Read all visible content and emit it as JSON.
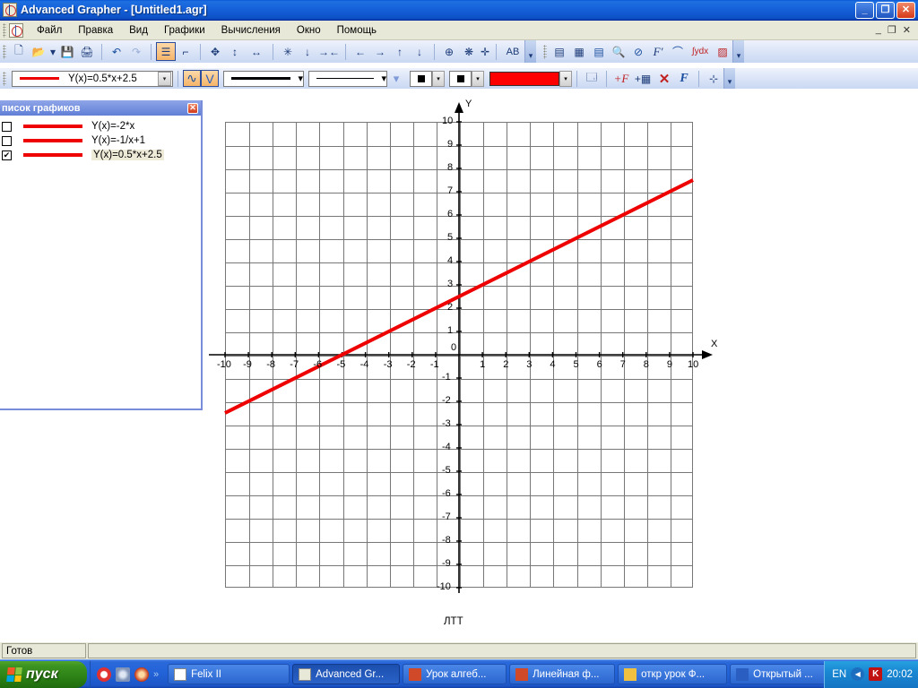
{
  "window": {
    "title": "Advanced Grapher - [Untitled1.agr]",
    "app_icon": "grapher-icon",
    "minimize": "_",
    "maximize": "❐",
    "close": "✕",
    "mdi_minimize": "_",
    "mdi_restore": "❐",
    "mdi_close": "✕"
  },
  "menu": {
    "items": [
      {
        "label": "Файл"
      },
      {
        "label": "Правка"
      },
      {
        "label": "Вид"
      },
      {
        "label": "Графики"
      },
      {
        "label": "Вычисления"
      },
      {
        "label": "Окно"
      },
      {
        "label": "Помощь"
      }
    ]
  },
  "toolbar_main": {
    "buttons": [
      {
        "name": "new-file-button",
        "glyph": "🗋"
      },
      {
        "name": "open-file-button",
        "glyph": "📂"
      },
      {
        "name": "open-dropdown-button",
        "glyph": "▾"
      },
      {
        "name": "save-button",
        "glyph": "💾"
      },
      {
        "name": "print-button",
        "glyph": "🖨"
      },
      {
        "name": "undo-button",
        "glyph": "↶"
      },
      {
        "name": "redo-button",
        "glyph": "↷"
      },
      {
        "name": "graph-list-button",
        "glyph": "☰"
      },
      {
        "name": "axes-settings-button",
        "glyph": "⌐"
      },
      {
        "name": "pan-button",
        "glyph": "✥"
      },
      {
        "name": "stretch-vertical-button",
        "glyph": "↕"
      },
      {
        "name": "stretch-horizontal-button",
        "glyph": "↔"
      },
      {
        "name": "zoom-in-button",
        "glyph": "✳"
      },
      {
        "name": "zoom-vertical-in-button",
        "glyph": "↓"
      },
      {
        "name": "zoom-horizontal-in-button",
        "glyph": "→←"
      },
      {
        "name": "scroll-left-button",
        "glyph": "←"
      },
      {
        "name": "scroll-right-button",
        "glyph": "→"
      },
      {
        "name": "scroll-up-button",
        "glyph": "↑"
      },
      {
        "name": "scroll-down-button",
        "glyph": "↓"
      },
      {
        "name": "center-origin-button",
        "glyph": "⊕"
      },
      {
        "name": "fit-all-button",
        "glyph": "❋"
      },
      {
        "name": "text-label-button",
        "glyph": "AB"
      }
    ],
    "overflow": "▾"
  },
  "toolbar_calc": {
    "buttons": [
      {
        "name": "table-button",
        "glyph": "▤"
      },
      {
        "name": "grid-table-button",
        "glyph": "▦"
      },
      {
        "name": "data-sheet-button",
        "glyph": "▤"
      },
      {
        "name": "trace-zoom-button",
        "glyph": "🔍"
      },
      {
        "name": "intersection-button",
        "glyph": "⊘"
      },
      {
        "name": "derivative-button",
        "glyph": "F'"
      },
      {
        "name": "tangent-button",
        "glyph": "⌒"
      },
      {
        "name": "integral-button",
        "glyph": "∫ydx"
      },
      {
        "name": "area-button",
        "glyph": "▨"
      }
    ],
    "overflow": "▾"
  },
  "toolbar_graph": {
    "formula_combo": {
      "name": "formula-combo",
      "value": "Y(x)=0.5*x+2.5",
      "line_color": "#ee0000",
      "arrow": "▾"
    },
    "style_buttons": [
      {
        "name": "function-style-button",
        "glyph": "∿",
        "active": true
      },
      {
        "name": "parabola-style-button",
        "glyph": "V",
        "active": true
      },
      {
        "name": "tabular-style-button",
        "glyph": "V",
        "active": false
      }
    ],
    "line_width_combo": {
      "name": "line-width-combo",
      "arrow": "▾"
    },
    "line_style_combo": {
      "name": "line-style-combo",
      "arrow": "▾"
    },
    "marker_combo": {
      "name": "marker-style-combo",
      "arrow": "▾"
    },
    "point_combo": {
      "name": "point-style-combo",
      "arrow": "▾"
    },
    "color_combo": {
      "name": "graph-color-combo",
      "color": "#ff0000",
      "arrow": "▾"
    },
    "buttons": [
      {
        "name": "graph-properties-button",
        "glyph": "🗔"
      },
      {
        "name": "add-function-button",
        "glyph": "+F"
      },
      {
        "name": "add-table-button",
        "glyph": "+▦"
      },
      {
        "name": "delete-graph-button",
        "glyph": "✕"
      },
      {
        "name": "edit-function-button",
        "glyph": "F"
      },
      {
        "name": "graph-properties2-button",
        "glyph": "⊹"
      }
    ],
    "overflow": "▾"
  },
  "graph_list": {
    "title": "писок графиков",
    "close": "✕",
    "rows": [
      {
        "checked": false,
        "label": "Y(x)=-2*x",
        "color": "#ee0000",
        "selected": false
      },
      {
        "checked": false,
        "label": "Y(x)=-1/x+1",
        "color": "#ee0000",
        "selected": false
      },
      {
        "checked": true,
        "label": "Y(x)=0.5*x+2.5",
        "color": "#ee0000",
        "selected": true
      }
    ],
    "check_glyph": "✔"
  },
  "plot": {
    "caption": "ЛТТ",
    "x_axis_name": "X",
    "y_axis_name": "Y",
    "x_ticks": [
      "-10",
      "-9",
      "-8",
      "-7",
      "-6",
      "-5",
      "-4",
      "-3",
      "-2",
      "-1",
      "0",
      "1",
      "2",
      "3",
      "4",
      "5",
      "6",
      "7",
      "8",
      "9",
      "10"
    ],
    "y_ticks": [
      "10",
      "9",
      "8",
      "7",
      "6",
      "5",
      "4",
      "3",
      "2",
      "1",
      "0",
      "-1",
      "-2",
      "-3",
      "-4",
      "-5",
      "-6",
      "-7",
      "-8",
      "-9",
      "-10"
    ]
  },
  "chart_data": {
    "type": "line",
    "title": "ЛТТ",
    "xlabel": "X",
    "ylabel": "Y",
    "xlim": [
      -10,
      10
    ],
    "ylim": [
      -10,
      10
    ],
    "grid": true,
    "legend": false,
    "xticks": [
      -10,
      -9,
      -8,
      -7,
      -6,
      -5,
      -4,
      -3,
      -2,
      -1,
      0,
      1,
      2,
      3,
      4,
      5,
      6,
      7,
      8,
      9,
      10
    ],
    "yticks": [
      -10,
      -9,
      -8,
      -7,
      -6,
      -5,
      -4,
      -3,
      -2,
      -1,
      0,
      1,
      2,
      3,
      4,
      5,
      6,
      7,
      8,
      9,
      10
    ],
    "series": [
      {
        "name": "Y(x)=0.5*x+2.5",
        "color": "#ee0000",
        "visible": true,
        "expression": "0.5*x+2.5",
        "x": [
          -10,
          10
        ],
        "y": [
          -2.5,
          7.5
        ]
      },
      {
        "name": "Y(x)=-2*x",
        "color": "#ee0000",
        "visible": false,
        "expression": "-2*x"
      },
      {
        "name": "Y(x)=-1/x+1",
        "color": "#ee0000",
        "visible": false,
        "expression": "-1/x+1"
      }
    ]
  },
  "status": {
    "message": "Готов"
  },
  "taskbar": {
    "start_label": "пуск",
    "quick_launch": [
      {
        "name": "quicklaunch-icon-1",
        "color": "#e03030"
      },
      {
        "name": "quicklaunch-icon-2",
        "color": "#8aa0c0"
      },
      {
        "name": "quicklaunch-icon-3",
        "color": "#d04020"
      }
    ],
    "overflow": "»",
    "tasks": [
      {
        "label": "Felix II",
        "active": false,
        "icon": "cards-icon"
      },
      {
        "label": "Advanced Gr...",
        "active": true,
        "icon": "grapher-icon"
      },
      {
        "label": "Урок алгеб...",
        "active": false,
        "icon": "powerpoint-icon"
      },
      {
        "label": "Линейная ф...",
        "active": false,
        "icon": "powerpoint-icon"
      },
      {
        "label": "откр урок Ф...",
        "active": false,
        "icon": "folder-icon"
      },
      {
        "label": "Открытый ...",
        "active": false,
        "icon": "word-icon"
      }
    ],
    "language": "EN",
    "tray_icons": [
      {
        "name": "volume-icon",
        "glyph": "◀"
      },
      {
        "name": "antivirus-icon",
        "glyph": "K"
      }
    ],
    "clock": "20:02"
  }
}
